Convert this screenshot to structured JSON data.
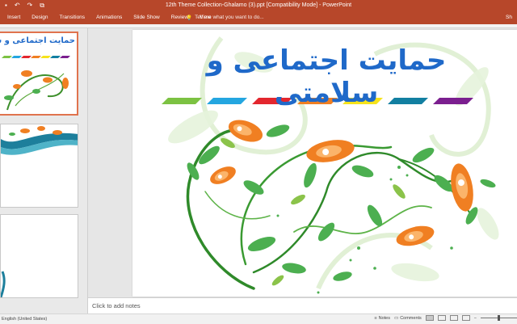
{
  "titlebar": {
    "title": "12th Theme Collection-Ghalamo (3).ppt [Compatibility Mode] - PowerPoint",
    "qat": [
      "save-icon",
      "undo-icon",
      "redo-icon",
      "present-icon"
    ]
  },
  "ribbon": {
    "tabs": [
      "Insert",
      "Design",
      "Transitions",
      "Animations",
      "Slide Show",
      "Review",
      "View"
    ],
    "tell_me": "Tell me what you want to do...",
    "share_partial": "Sh"
  },
  "slide": {
    "title": "حمایت اجتماعی و سلامتی",
    "thumb_title": "حمایت اجتماعی و س",
    "bar_colors": [
      "#7cc242",
      "#24a6e0",
      "#e3262e",
      "#f07f22",
      "#f6e31b",
      "#127fa1",
      "#7b1f8f"
    ]
  },
  "notes": {
    "placeholder": "Click to add notes"
  },
  "status": {
    "language": "English (United States)",
    "notes_label": "Notes",
    "comments_label": "Comments"
  }
}
